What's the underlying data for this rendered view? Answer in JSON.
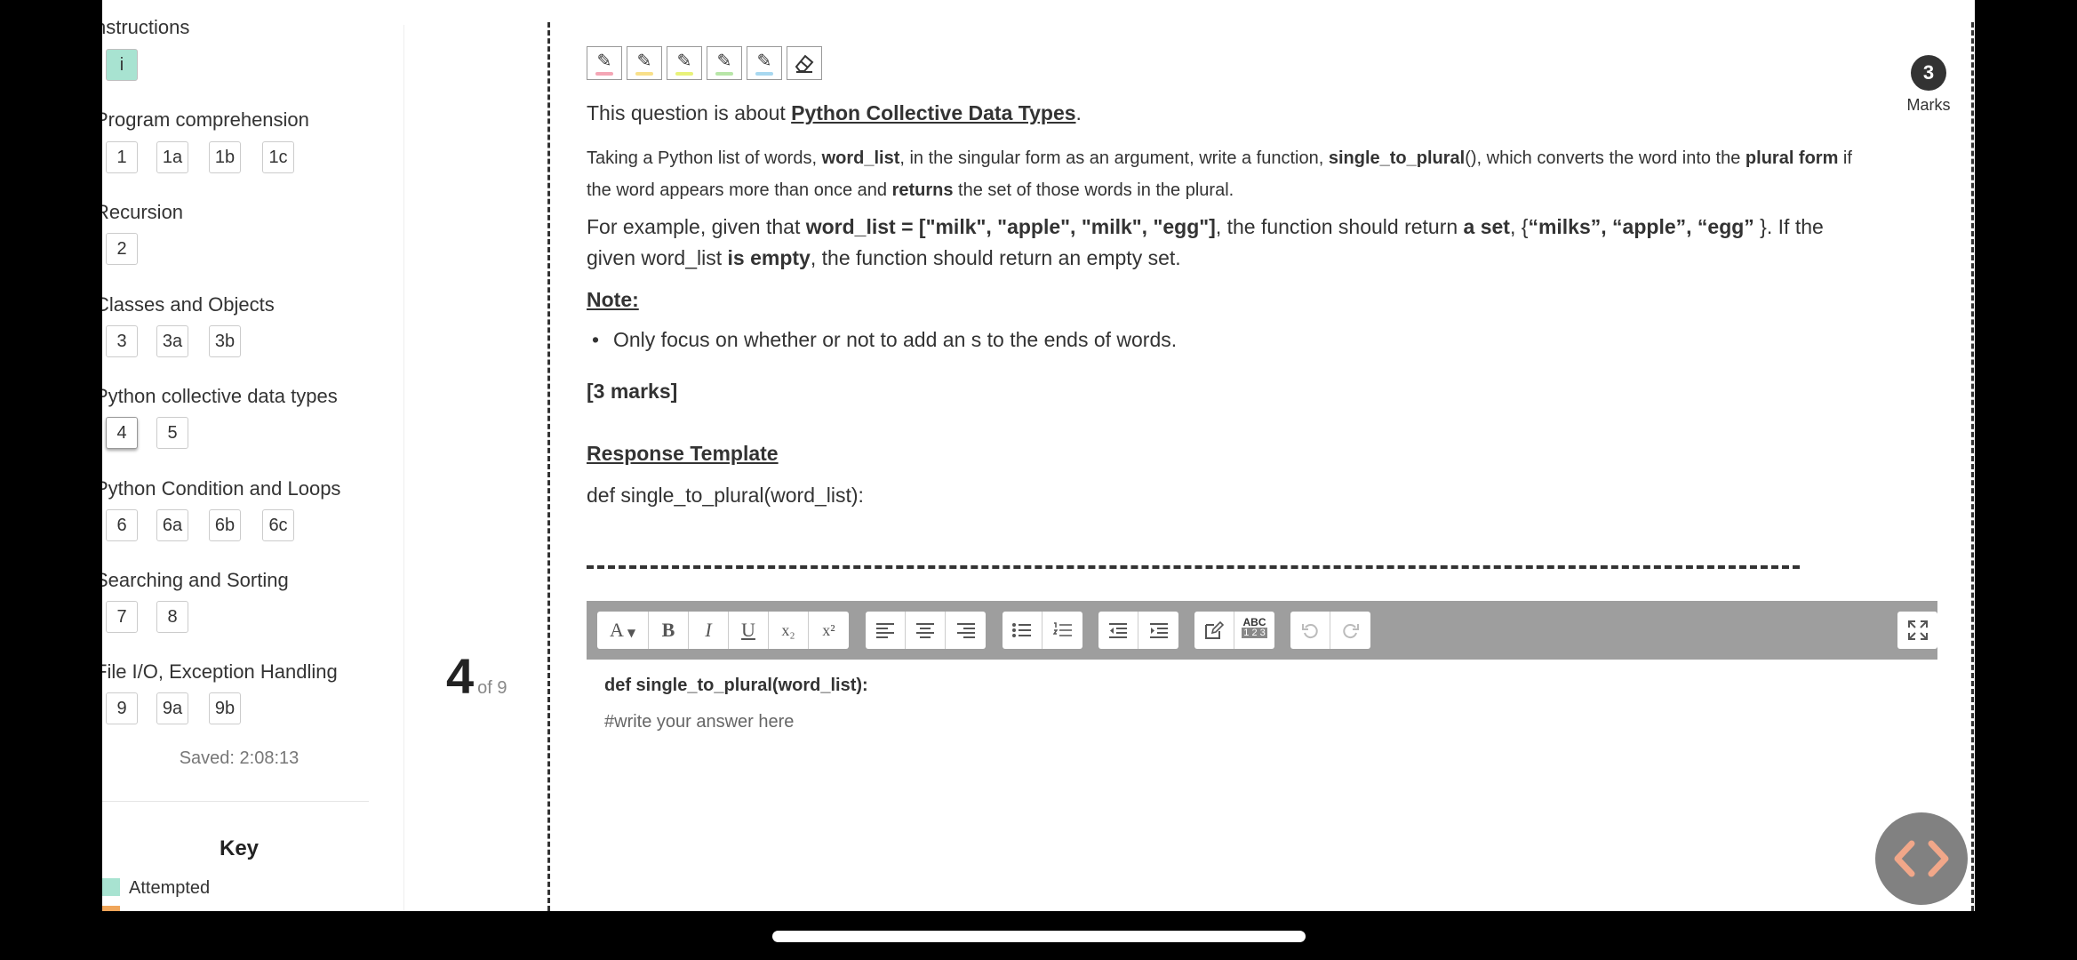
{
  "sidebar": {
    "sections": [
      {
        "title": "nstructions",
        "items": [
          "i"
        ]
      },
      {
        "title": "Program comprehension",
        "items": [
          "1",
          "1a",
          "1b",
          "1c"
        ]
      },
      {
        "title": "Recursion",
        "items": [
          "2"
        ]
      },
      {
        "title": "Classes and Objects",
        "items": [
          "3",
          "3a",
          "3b"
        ]
      },
      {
        "title": "Python collective data types",
        "items": [
          "4",
          "5"
        ]
      },
      {
        "title": "Python Condition and Loops",
        "items": [
          "6",
          "6a",
          "6b",
          "6c"
        ]
      },
      {
        "title": "Searching and Sorting",
        "items": [
          "7",
          "8"
        ]
      },
      {
        "title": "File I/O, Exception Handling",
        "items": [
          "9",
          "9a",
          "9b"
        ]
      }
    ],
    "saved": "Saved: 2:08:13",
    "key": {
      "title": "Key",
      "attempted": "Attempted",
      "attempted_color": "#a8e3d1",
      "flagged_color": "#f0a65a"
    }
  },
  "counter": {
    "current": "4",
    "of": "of 9"
  },
  "question": {
    "intro_prefix": "This question is about ",
    "intro_topic": "Python Collective Data Types",
    "intro_suffix": ".",
    "para1": {
      "t1": "Taking a Python list of words, ",
      "b1": "word_list",
      "t2": ", in the singular form as an argument, write a function, ",
      "b2": "single_to_plural",
      "t3": "(), which converts the word into the ",
      "b3": "plural form",
      "t4": " if the word appears more than once and ",
      "b4": "returns",
      "t5": " the set of those words in the plural."
    },
    "para2": {
      "t1": "For example, given that ",
      "b1": "word_list = [\"milk\", \"apple\", \"milk\", \"egg\"]",
      "t2": ", the function should return ",
      "b2": "a set",
      "t3": ", {",
      "b3": "“milks”, “apple”, “egg”",
      "t4": " }. If the given word_list ",
      "b4": "is empty",
      "t5": ", the function should return an empty set."
    },
    "note_head": "Note:",
    "note_bullet": "Only focus on whether or not to add an s to the ends of words.",
    "marks_text": "[3 marks]",
    "template_head": "Response Template",
    "template_code": "def single_to_plural(word_list):"
  },
  "marks_badge": {
    "value": "3",
    "label": "Marks"
  },
  "editor": {
    "line1": "def single_to_plural(word_list):",
    "line2": "#write your answer here",
    "toolbar": {
      "font": "A",
      "bold": "B",
      "italic": "I",
      "underline": "U",
      "subscript": "x₂",
      "superscript": "x²",
      "spell_top": "ABC",
      "spell_bottom": "1 2 3"
    }
  },
  "pens": [
    {
      "icon": "✎",
      "color": "#f4a6b5"
    },
    {
      "icon": "✎",
      "color": "#f9e08a"
    },
    {
      "icon": "✎",
      "color": "#e9f27a"
    },
    {
      "icon": "✎",
      "color": "#b8e6a8"
    },
    {
      "icon": "✎",
      "color": "#a8d8f0"
    }
  ]
}
